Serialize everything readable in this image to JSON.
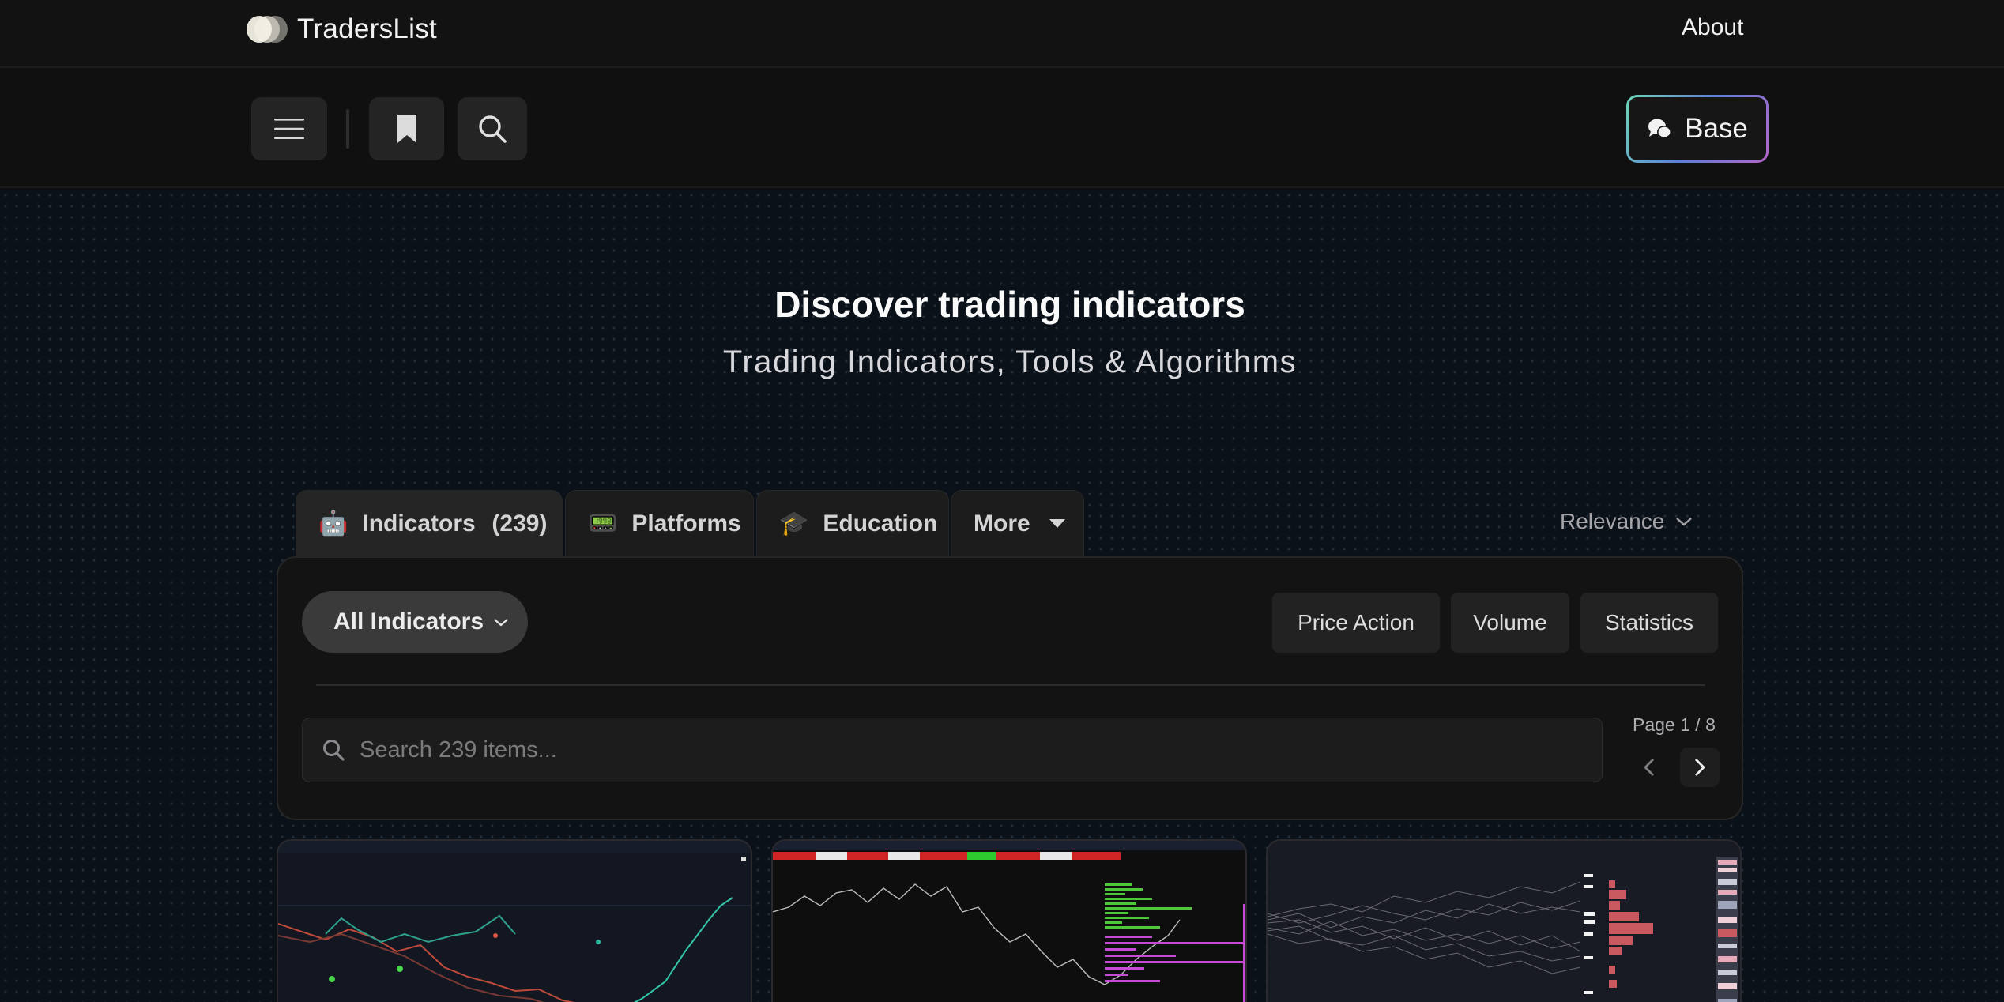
{
  "header": {
    "brand": "TradersList",
    "about_label": "About"
  },
  "toolbar": {
    "menu_icon": "hamburger-icon",
    "bookmark_icon": "bookmark-icon",
    "search_icon": "search-icon",
    "base_label": "Base",
    "base_icon": "chat-bubbles-icon"
  },
  "hero": {
    "title": "Discover trading indicators",
    "subtitle": "Trading Indicators, Tools & Algorithms"
  },
  "tabs": [
    {
      "emoji": "🤖",
      "label": "Indicators",
      "count": "(239)",
      "active": true
    },
    {
      "emoji": "📟",
      "label": "Platforms"
    },
    {
      "emoji": "🎓",
      "label": "Education"
    },
    {
      "label": "More"
    }
  ],
  "sort": {
    "label": "Relevance"
  },
  "filters": {
    "all_label": "All Indicators",
    "chips": [
      "Price Action",
      "Volume",
      "Statistics"
    ]
  },
  "search": {
    "placeholder": "Search 239 items...",
    "value": ""
  },
  "pagination": {
    "label": "Page 1 / 8",
    "current": 1,
    "total": 8
  },
  "cards": [
    {
      "thumbnail": "candlestick-chart-thumbnail"
    },
    {
      "thumbnail": "price-ladder-thumbnail"
    },
    {
      "thumbnail": "monte-carlo-histogram-thumbnail"
    }
  ],
  "colors": {
    "accent_gradient": [
      "#6fd6b8",
      "#5c7fd6",
      "#b466c8"
    ],
    "background": "#0b1118"
  }
}
